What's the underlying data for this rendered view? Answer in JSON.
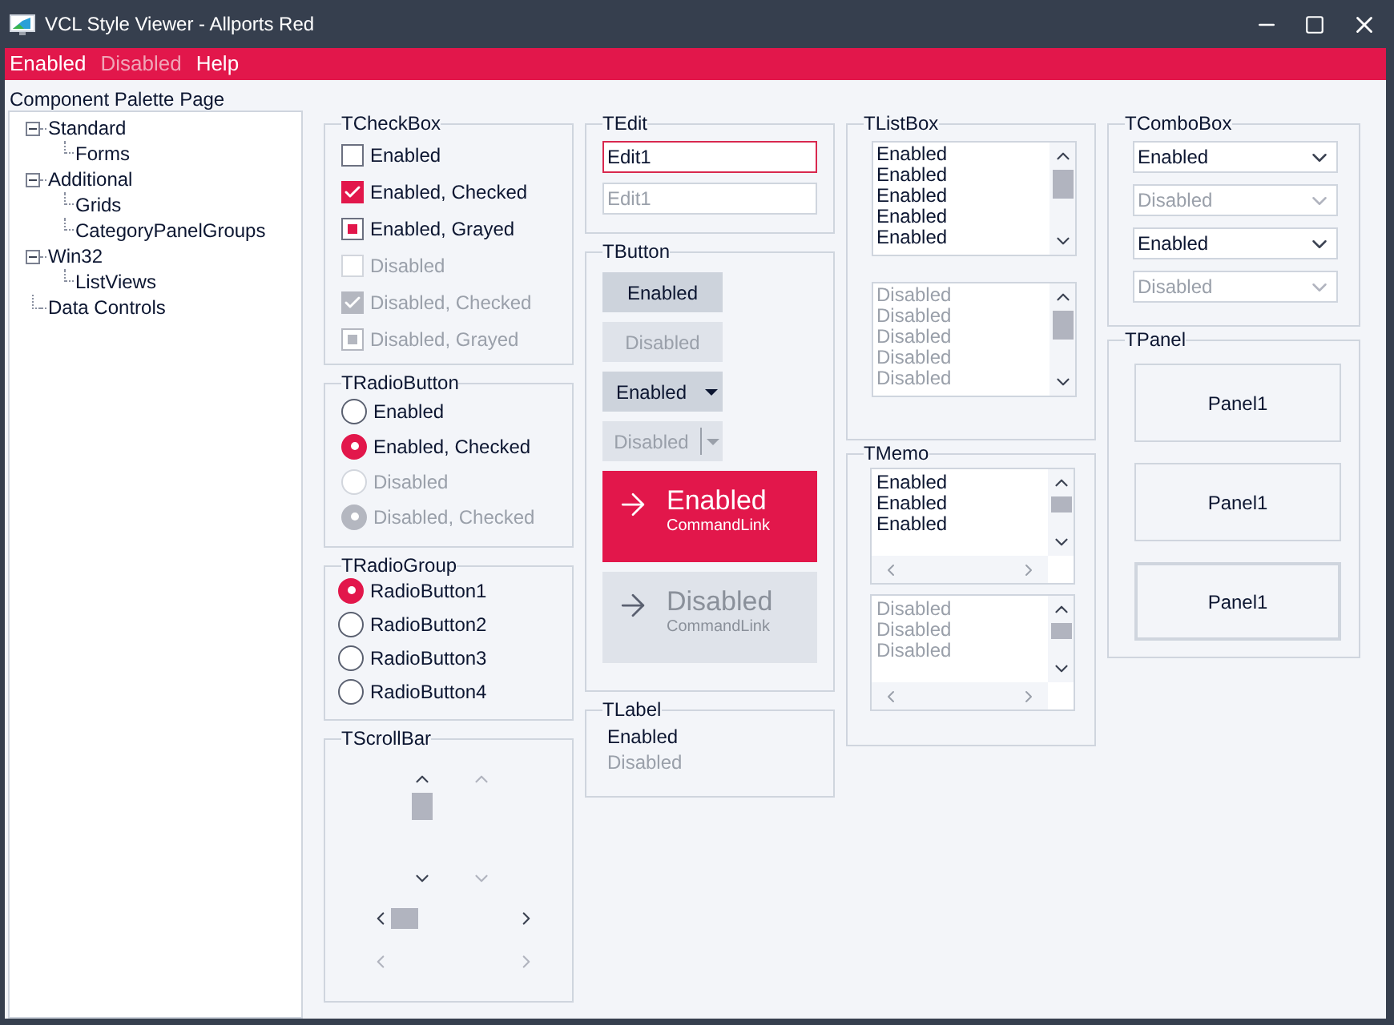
{
  "window": {
    "title": "VCL Style Viewer - Allports Red"
  },
  "menu": [
    {
      "label": "Enabled",
      "disabled": false
    },
    {
      "label": "Disabled",
      "disabled": true
    },
    {
      "label": "Help",
      "disabled": false
    }
  ],
  "palette": {
    "label": "Component Palette Page",
    "tree": [
      {
        "label": "Standard",
        "expanded": true,
        "children": [
          {
            "label": "Forms"
          }
        ]
      },
      {
        "label": "Additional",
        "expanded": true,
        "children": [
          {
            "label": "Grids"
          },
          {
            "label": "CategoryPanelGroups"
          }
        ]
      },
      {
        "label": "Win32",
        "expanded": true,
        "children": [
          {
            "label": "ListViews"
          }
        ]
      },
      {
        "label": "Data Controls"
      }
    ]
  },
  "checkbox_group": {
    "title": "TCheckBox",
    "items": [
      {
        "label": "Enabled",
        "checked": false,
        "grayed": false,
        "disabled": false
      },
      {
        "label": "Enabled, Checked",
        "checked": true,
        "grayed": false,
        "disabled": false
      },
      {
        "label": "Enabled, Grayed",
        "checked": true,
        "grayed": true,
        "disabled": false
      },
      {
        "label": "Disabled",
        "checked": false,
        "grayed": false,
        "disabled": true
      },
      {
        "label": "Disabled, Checked",
        "checked": true,
        "grayed": false,
        "disabled": true
      },
      {
        "label": "Disabled, Grayed",
        "checked": true,
        "grayed": true,
        "disabled": true
      }
    ]
  },
  "radio_buttons": {
    "title": "TRadioButton",
    "items": [
      {
        "label": "Enabled",
        "selected": false,
        "disabled": false
      },
      {
        "label": "Enabled, Checked",
        "selected": true,
        "disabled": false
      },
      {
        "label": "Disabled",
        "selected": false,
        "disabled": true
      },
      {
        "label": "Disabled, Checked",
        "selected": true,
        "disabled": true
      }
    ]
  },
  "radio_group": {
    "title": "TRadioGroup",
    "items": [
      {
        "label": "RadioButton1",
        "selected": true
      },
      {
        "label": "RadioButton2",
        "selected": false
      },
      {
        "label": "RadioButton3",
        "selected": false
      },
      {
        "label": "RadioButton4",
        "selected": false
      }
    ]
  },
  "scrollbar_group": {
    "title": "TScrollBar"
  },
  "edit_group": {
    "title": "TEdit",
    "fields": [
      {
        "value": "Edit1",
        "disabled": false,
        "focused": true
      },
      {
        "value": "Edit1",
        "disabled": true,
        "focused": false
      }
    ]
  },
  "button_group": {
    "title": "TButton",
    "items": [
      {
        "kind": "button",
        "label": "Enabled",
        "disabled": false
      },
      {
        "kind": "button",
        "label": "Disabled",
        "disabled": true
      },
      {
        "kind": "split",
        "label": "Enabled",
        "disabled": false
      },
      {
        "kind": "split",
        "label": "Disabled",
        "disabled": true
      },
      {
        "kind": "command_link",
        "label": "Enabled",
        "note": "CommandLink",
        "disabled": false
      },
      {
        "kind": "command_link",
        "label": "Disabled",
        "note": "CommandLink",
        "disabled": true
      }
    ]
  },
  "label_group": {
    "title": "TLabel",
    "items": [
      {
        "text": "Enabled",
        "disabled": false
      },
      {
        "text": "Disabled",
        "disabled": true
      }
    ]
  },
  "listbox_group": {
    "title": "TListBox",
    "lists": [
      {
        "disabled": false,
        "items": [
          "Enabled",
          "Enabled",
          "Enabled",
          "Enabled",
          "Enabled"
        ]
      },
      {
        "disabled": true,
        "items": [
          "Disabled",
          "Disabled",
          "Disabled",
          "Disabled",
          "Disabled"
        ]
      }
    ]
  },
  "memo_group": {
    "title": "TMemo",
    "memos": [
      {
        "disabled": false,
        "lines": [
          "Enabled",
          "Enabled",
          "Enabled"
        ]
      },
      {
        "disabled": true,
        "lines": [
          "Disabled",
          "Disabled",
          "Disabled"
        ]
      }
    ]
  },
  "combobox_group": {
    "title": "TComboBox",
    "items": [
      {
        "value": "Enabled",
        "disabled": false
      },
      {
        "value": "Disabled",
        "disabled": true
      },
      {
        "value": "Enabled",
        "disabled": false
      },
      {
        "value": "Disabled",
        "disabled": true
      }
    ]
  },
  "panel_group": {
    "title": "TPanel",
    "panels": [
      {
        "caption": "Panel1",
        "double_border": false
      },
      {
        "caption": "Panel1",
        "double_border": false
      },
      {
        "caption": "Panel1",
        "double_border": true
      }
    ]
  }
}
